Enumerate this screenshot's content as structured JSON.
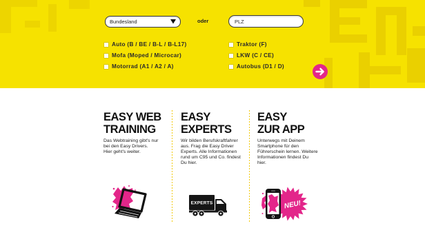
{
  "search": {
    "bundesland": {
      "selected": "Bundesland",
      "icon": "triangle-down-icon"
    },
    "or_label": "oder",
    "plz": {
      "value": "",
      "placeholder": "PLZ"
    }
  },
  "license_classes": {
    "left": [
      {
        "label": "Auto (B / BE / B-L / B-L17)",
        "checked": false
      },
      {
        "label": "Mofa (Moped / Microcar)",
        "checked": false
      },
      {
        "label": "Motorrad (A1 / A2 / A)",
        "checked": false
      }
    ],
    "right": [
      {
        "label": "Traktor (F)",
        "checked": false
      },
      {
        "label": "LKW (C / CE)",
        "checked": false
      },
      {
        "label": "Autobus (D1 / D)",
        "checked": false
      }
    ]
  },
  "submit": {
    "icon": "arrow-right-icon"
  },
  "features": [
    {
      "heading": [
        "EASY WEB",
        "TRAINING"
      ],
      "text_lines": [
        "Das Webtraining gibt's nur",
        "bei den Easy Drivers.",
        "Hier geht's weiter."
      ],
      "icon": "laptop-icon"
    },
    {
      "heading": [
        "EASY",
        "EXPERTS"
      ],
      "text_lines": [
        "Wir bilden Berufskraftfahrer",
        "aus. Frag die Easy Driver",
        "Experts. Alle Informationen",
        "rund um C95 und Co. findest",
        "Du hier."
      ],
      "icon": "truck-icon",
      "icon_label": "EXPERTS"
    },
    {
      "heading": [
        "EASY",
        "ZUR APP"
      ],
      "text_lines": [
        "Unterwegs mit Deinem",
        "Smartphone für den",
        "Führerschein lernen. Weitere",
        "Informationen findest Du",
        "hier."
      ],
      "icon": "smartphone-icon",
      "badge": "NEU!"
    }
  ],
  "colors": {
    "brand_yellow": "#f6e200",
    "accent_pink": "#e3268a",
    "separator": "#f2c900",
    "text": "#151515"
  }
}
